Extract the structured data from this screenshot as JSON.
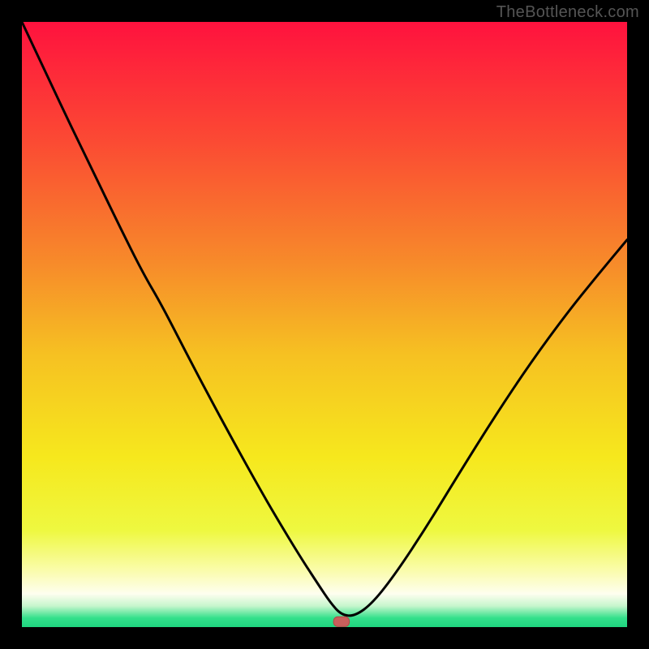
{
  "watermark": "TheBottleneck.com",
  "colors": {
    "frame": "#000000",
    "watermark_text": "#555555",
    "curve": "#000000",
    "marker_fill": "#c95f5c",
    "marker_stroke": "#b34b48",
    "gradient_stops": [
      {
        "offset": 0.0,
        "color": "#ff123e"
      },
      {
        "offset": 0.2,
        "color": "#fb4b33"
      },
      {
        "offset": 0.4,
        "color": "#f78b2a"
      },
      {
        "offset": 0.55,
        "color": "#f6c122"
      },
      {
        "offset": 0.72,
        "color": "#f6e81d"
      },
      {
        "offset": 0.84,
        "color": "#eef840"
      },
      {
        "offset": 0.905,
        "color": "#fafca9"
      },
      {
        "offset": 0.945,
        "color": "#fefeef"
      },
      {
        "offset": 0.965,
        "color": "#c7f6cd"
      },
      {
        "offset": 0.985,
        "color": "#33e08b"
      },
      {
        "offset": 1.0,
        "color": "#1fd57f"
      }
    ]
  },
  "chart_data": {
    "type": "line",
    "title": "",
    "xlabel": "",
    "ylabel": "",
    "legend": null,
    "marker": {
      "x": 0.528,
      "y": 0.0,
      "label": ""
    },
    "x": [
      0.0,
      0.04,
      0.08,
      0.12,
      0.16,
      0.2,
      0.23,
      0.27,
      0.31,
      0.35,
      0.39,
      0.42,
      0.46,
      0.49,
      0.51,
      0.528,
      0.55,
      0.58,
      0.62,
      0.67,
      0.72,
      0.78,
      0.84,
      0.9,
      0.95,
      1.0
    ],
    "y": [
      1.0,
      0.915,
      0.83,
      0.748,
      0.665,
      0.585,
      0.534,
      0.456,
      0.38,
      0.306,
      0.234,
      0.182,
      0.116,
      0.07,
      0.04,
      0.02,
      0.018,
      0.04,
      0.092,
      0.168,
      0.25,
      0.346,
      0.436,
      0.518,
      0.58,
      0.64
    ],
    "xlim": [
      0,
      1
    ],
    "ylim": [
      0,
      1
    ],
    "grid": false
  }
}
